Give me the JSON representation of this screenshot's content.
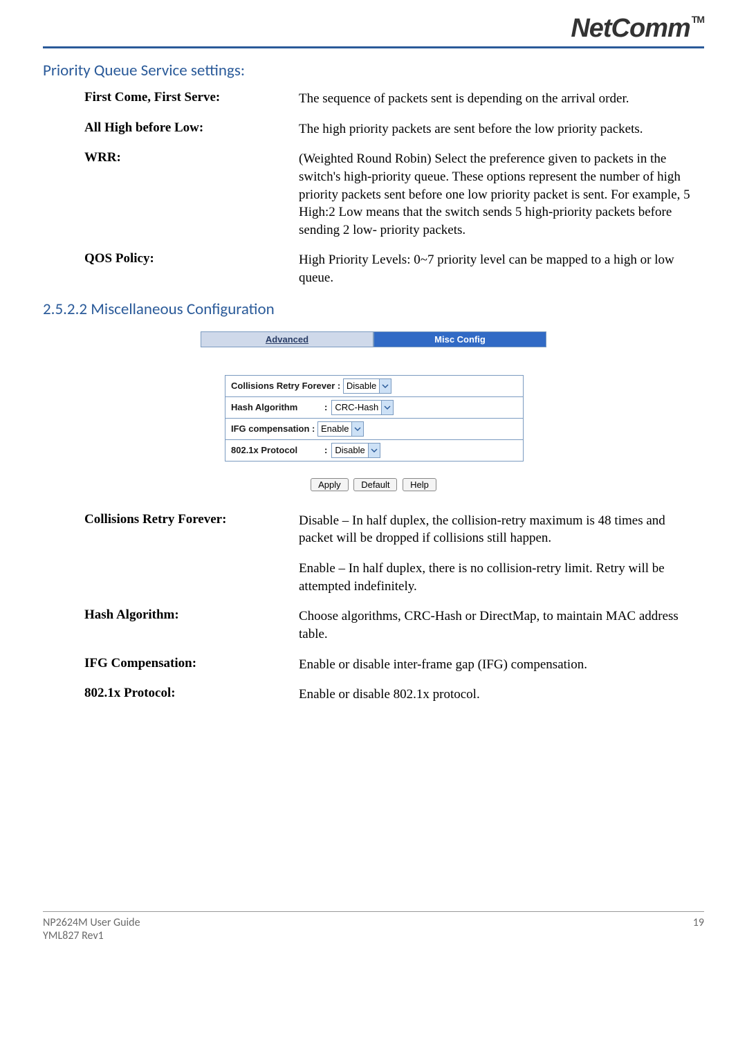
{
  "brand": "NetComm",
  "tm": "TM",
  "section1_title": "Priority Queue Service settings:",
  "pq": [
    {
      "term": "First Come, First Serve:",
      "desc": "The sequence of packets sent is depending on the arrival order."
    },
    {
      "term": "All High before Low:",
      "desc": "The high priority packets are sent before the low priority packets."
    },
    {
      "term": "WRR:",
      "desc": "(Weighted Round Robin)  Select the preference given to packets in the switch's high-priority queue.  These options represent the number of high priority packets sent before one low priority packet is sent.  For example, 5 High:2 Low means that the switch sends 5 high-priority packets before sending 2 low- priority packets."
    },
    {
      "term": "QOS Policy:",
      "desc": "High Priority Levels: 0~7 priority level can be mapped to a high or low queue."
    }
  ],
  "section2_title": "2.5.2.2 Miscellaneous Configuration",
  "tabs": {
    "advanced": "Advanced",
    "misc": "Misc Config"
  },
  "conf": {
    "crf": {
      "label": "Collisions Retry Forever :",
      "value": "Disable"
    },
    "hash": {
      "label": "Hash Algorithm",
      "value": "CRC-Hash"
    },
    "ifg": {
      "label": "IFG compensation :",
      "value": "Enable"
    },
    "dot1x": {
      "label": "802.1x Protocol",
      "value": "Disable"
    }
  },
  "buttons": {
    "apply": "Apply",
    "default": "Default",
    "help": "Help"
  },
  "misc": [
    {
      "term": "Collisions Retry Forever:",
      "desc": "Disable – In half duplex, the collision-retry maximum is 48 times and packet will be dropped if collisions still happen."
    },
    {
      "term": "",
      "desc": "Enable – In half duplex, there is no collision-retry limit.  Retry will be attempted indefinitely."
    },
    {
      "term": "Hash Algorithm:",
      "desc": "Choose algorithms, CRC-Hash or DirectMap, to maintain MAC address table."
    },
    {
      "term": "IFG Compensation:",
      "desc": "Enable or disable inter-frame gap (IFG) compensation."
    },
    {
      "term": "802.1x Protocol:",
      "desc": "Enable or disable 802.1x protocol."
    }
  ],
  "footer": {
    "guide": "NP2624M User Guide",
    "rev": "YML827 Rev1",
    "page": "19"
  }
}
